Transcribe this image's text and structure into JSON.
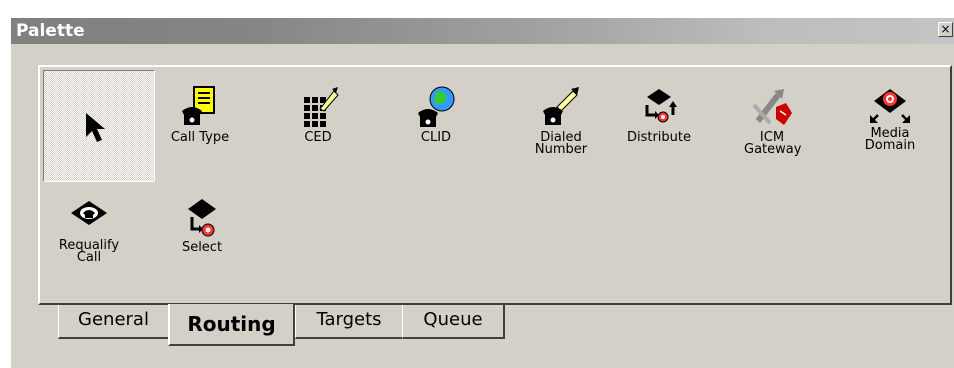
{
  "window": {
    "title": "Palette",
    "close_glyph": "×"
  },
  "tools": [
    {
      "name": "pointer",
      "label": "",
      "icon": "arrow-pointer-icon"
    },
    {
      "name": "call-type",
      "label": "Call Type",
      "icon": "call-type-icon"
    },
    {
      "name": "ced",
      "label": "CED",
      "icon": "ced-icon"
    },
    {
      "name": "clid",
      "label": "CLID",
      "icon": "clid-icon"
    },
    {
      "name": "dialed-number",
      "label": "Dialed Number",
      "icon": "dialed-number-icon"
    },
    {
      "name": "distribute",
      "label": "Distribute",
      "icon": "distribute-icon"
    },
    {
      "name": "icm-gateway",
      "label": "ICM Gateway",
      "icon": "icm-gateway-icon"
    },
    {
      "name": "media-domain",
      "label": "Media Domain",
      "icon": "media-domain-icon"
    },
    {
      "name": "requalify-call",
      "label": "Requalify Call",
      "icon": "requalify-call-icon"
    },
    {
      "name": "select",
      "label": "Select",
      "icon": "select-icon"
    }
  ],
  "tabs": [
    {
      "label": "General",
      "active": false
    },
    {
      "label": "Routing",
      "active": true
    },
    {
      "label": "Targets",
      "active": false
    },
    {
      "label": "Queue",
      "active": false
    }
  ],
  "colors": {
    "window_bg": "#d4d0c8",
    "title_start": "#808080",
    "title_end": "#c4c4c4"
  }
}
